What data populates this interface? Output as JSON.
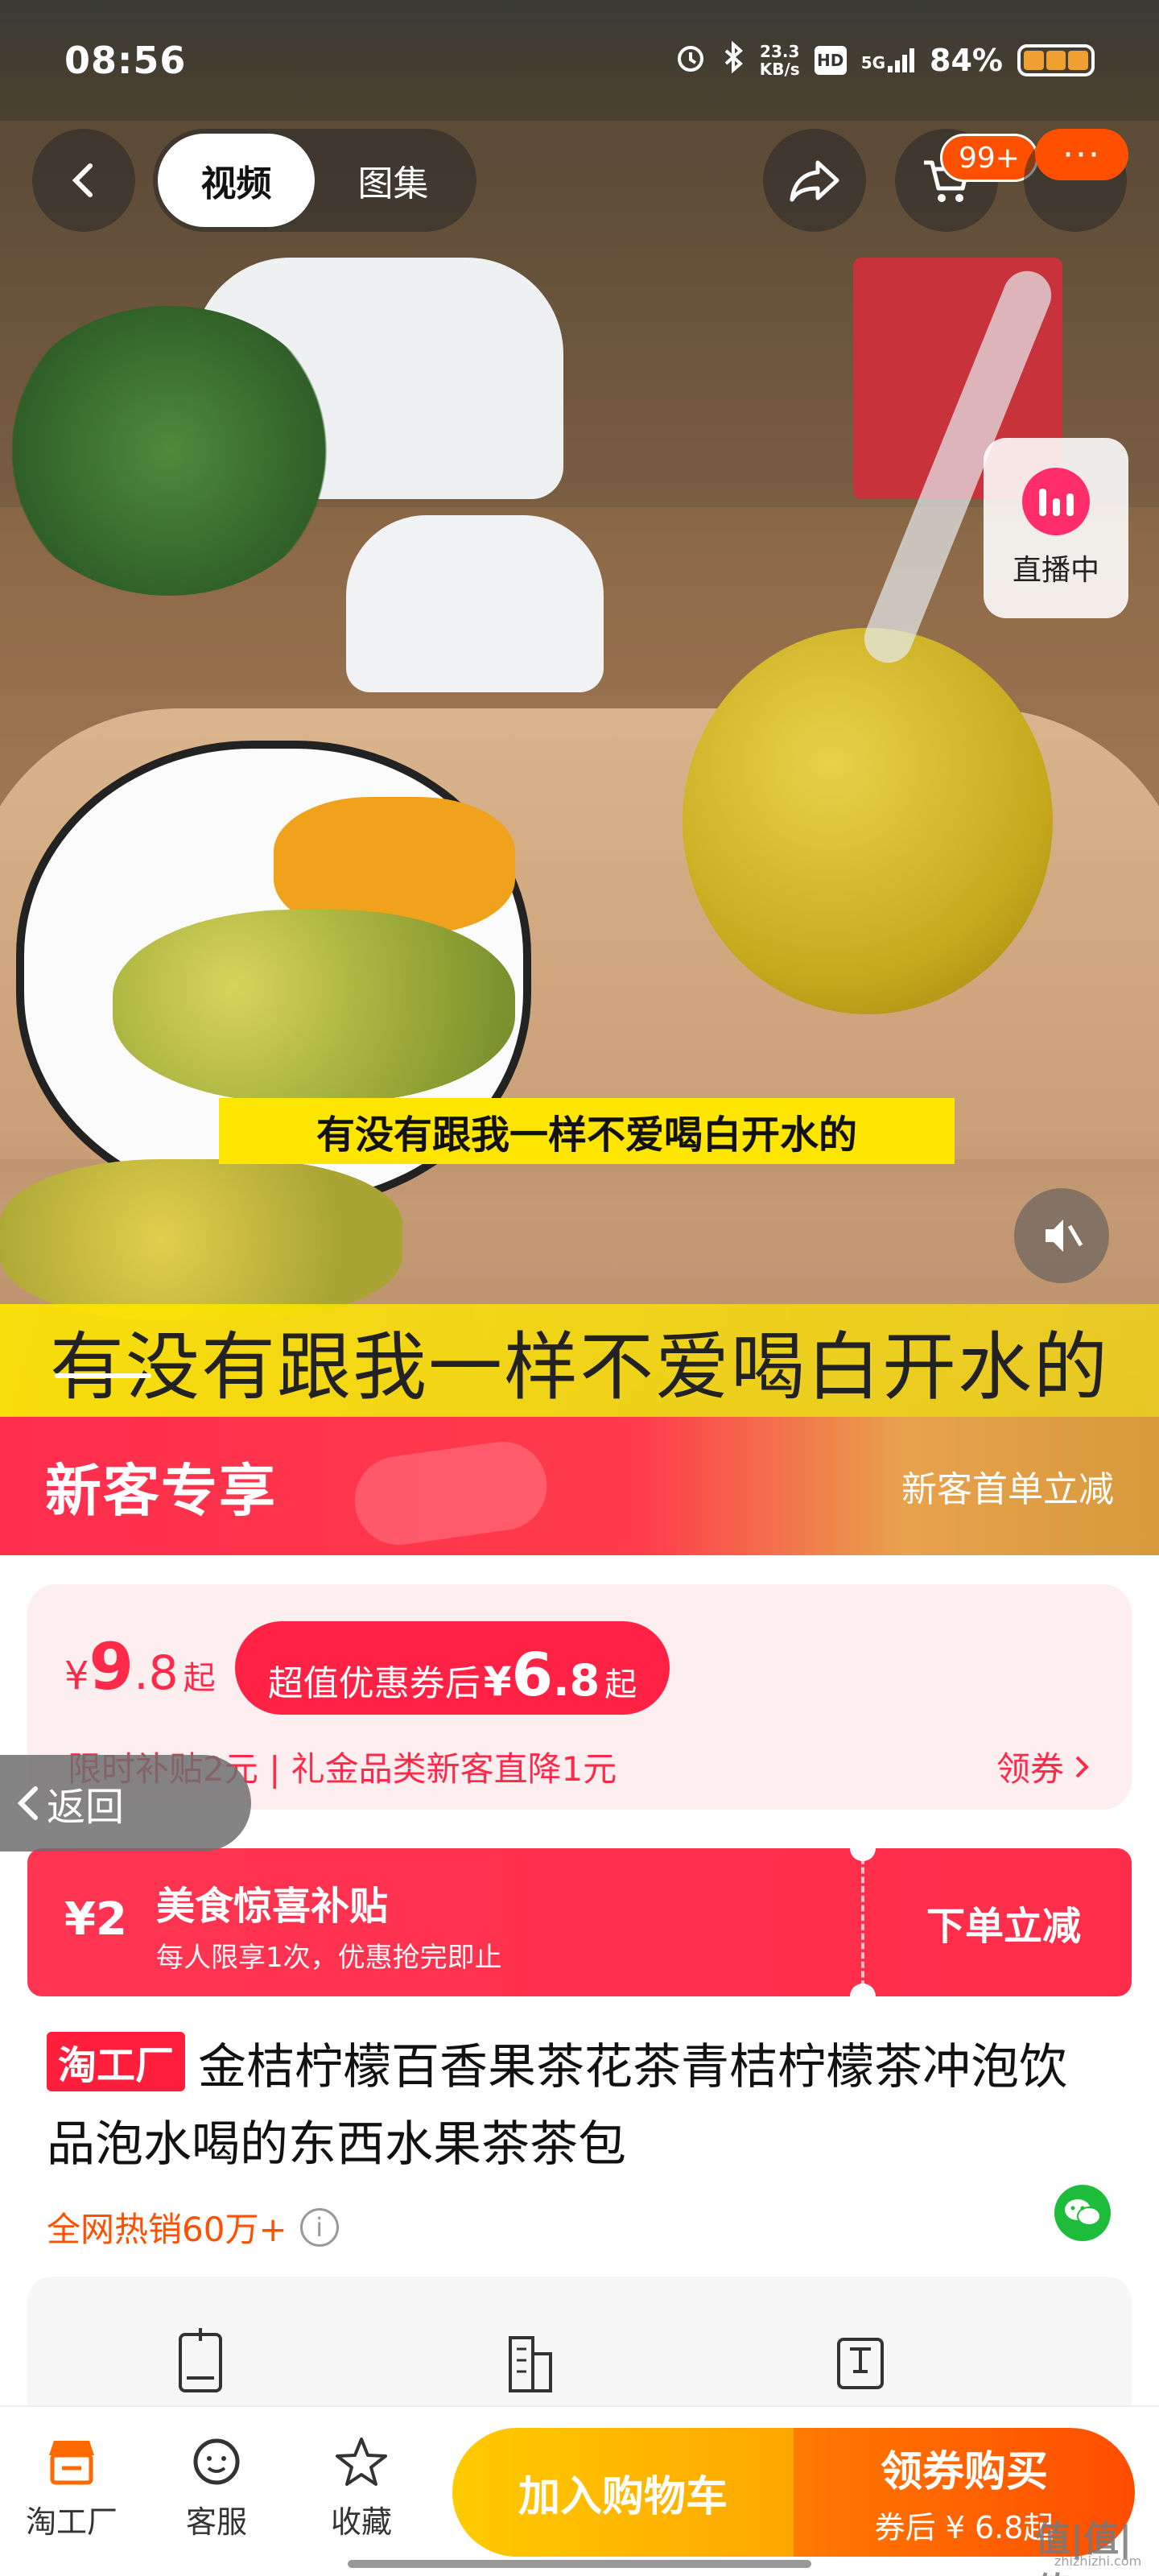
{
  "status_bar": {
    "time": "08:56",
    "net_speed_value": "23.3",
    "net_speed_unit": "KB/s",
    "hd_label": "HD",
    "network": "5G",
    "battery": "84%"
  },
  "top_nav": {
    "tabs": [
      {
        "label": "视频",
        "active": true
      },
      {
        "label": "图集",
        "active": false
      }
    ],
    "cart_badge": "99+",
    "more_label": "···"
  },
  "media": {
    "live_label": "直播中",
    "subtitle_small": "有没有跟我一样不爱喝白开水的",
    "subtitle_large": "有没有跟我一样不爱喝白开水的"
  },
  "new_customer": {
    "title": "新客专享",
    "subtitle": "新客首单立减"
  },
  "price": {
    "currency": "¥",
    "integer": "9",
    "decimal": ".8",
    "suffix": "起",
    "coupon_text": "超值优惠券后",
    "coupon_currency": "¥",
    "coupon_integer": "6",
    "coupon_decimal": ".8",
    "coupon_suffix": "起",
    "subline": "限时补贴2元 | 礼金品类新客直降1元",
    "get_coupon": "领券"
  },
  "back_float": {
    "label": "返回"
  },
  "subsidy": {
    "amount": "¥2",
    "title": "美食惊喜补贴",
    "desc": "每人限享1次，优惠抢完即止",
    "action": "下单立减"
  },
  "product": {
    "brand_tag": "淘工厂",
    "title": "金桔柠檬百香果茶花茶青桔柠檬茶冲泡饮品泡水喝的东西水果茶茶包",
    "hot_sales": "全网热销60万+"
  },
  "bottom_bar": {
    "items": [
      {
        "label": "淘工厂",
        "icon": "shop-icon"
      },
      {
        "label": "客服",
        "icon": "customer-service-icon"
      },
      {
        "label": "收藏",
        "icon": "star-icon"
      }
    ],
    "add_to_cart": "加入购物车",
    "buy_main": "领券购买",
    "buy_sub": "券后 ¥ 6.8起"
  },
  "watermark": {
    "text": "值|值|值",
    "sub": "zhizhizhi.com"
  },
  "colors": {
    "accent_red": "#ff2245",
    "taobao_orange": "#ff5000",
    "cart_yellow": "#ffcb00"
  }
}
